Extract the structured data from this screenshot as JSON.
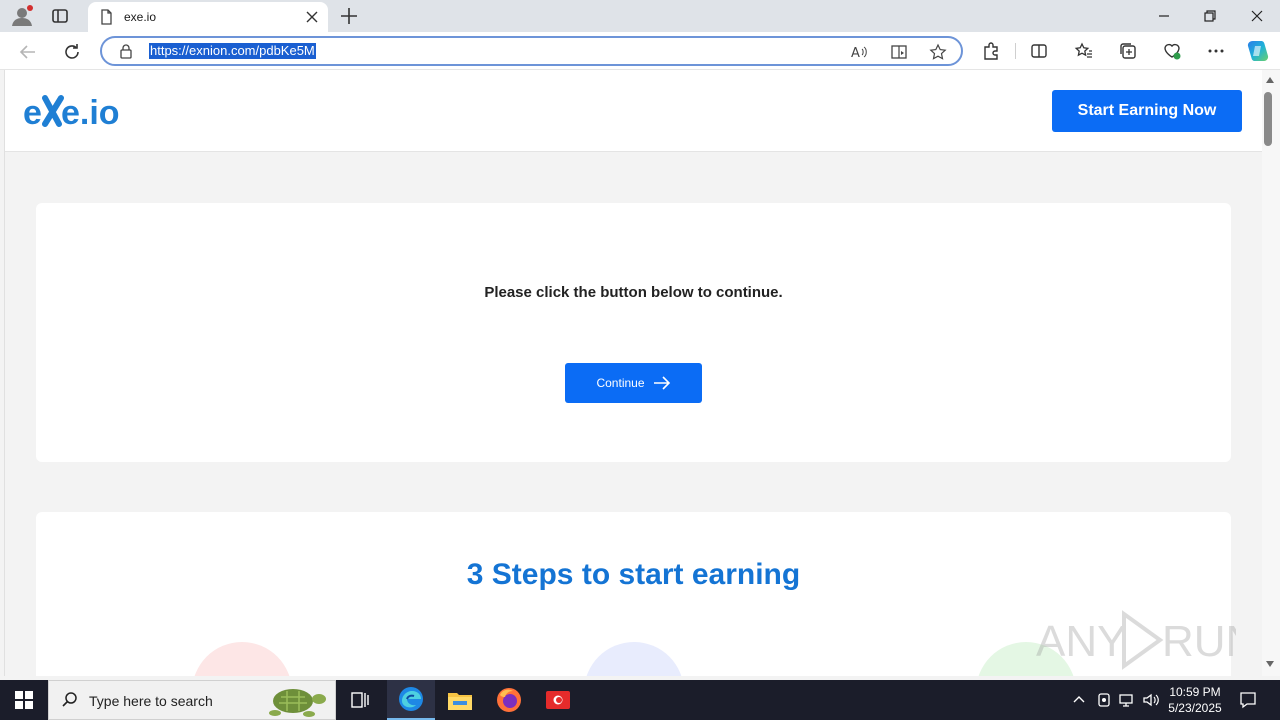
{
  "browser": {
    "tab_title": "exe.io",
    "url": "https://exnion.com/pdbKe5M"
  },
  "site": {
    "cta_label": "Start Earning Now",
    "message": "Please click the button below to continue.",
    "continue_label": "Continue",
    "steps_heading": "3 Steps to start earning",
    "brand_color": "#0b6cf5",
    "heading_color": "#1474d4"
  },
  "watermark": {
    "text": "ANY RUN"
  },
  "taskbar": {
    "search_placeholder": "Type here to search",
    "time": "10:59 PM",
    "date": "5/23/2025"
  }
}
